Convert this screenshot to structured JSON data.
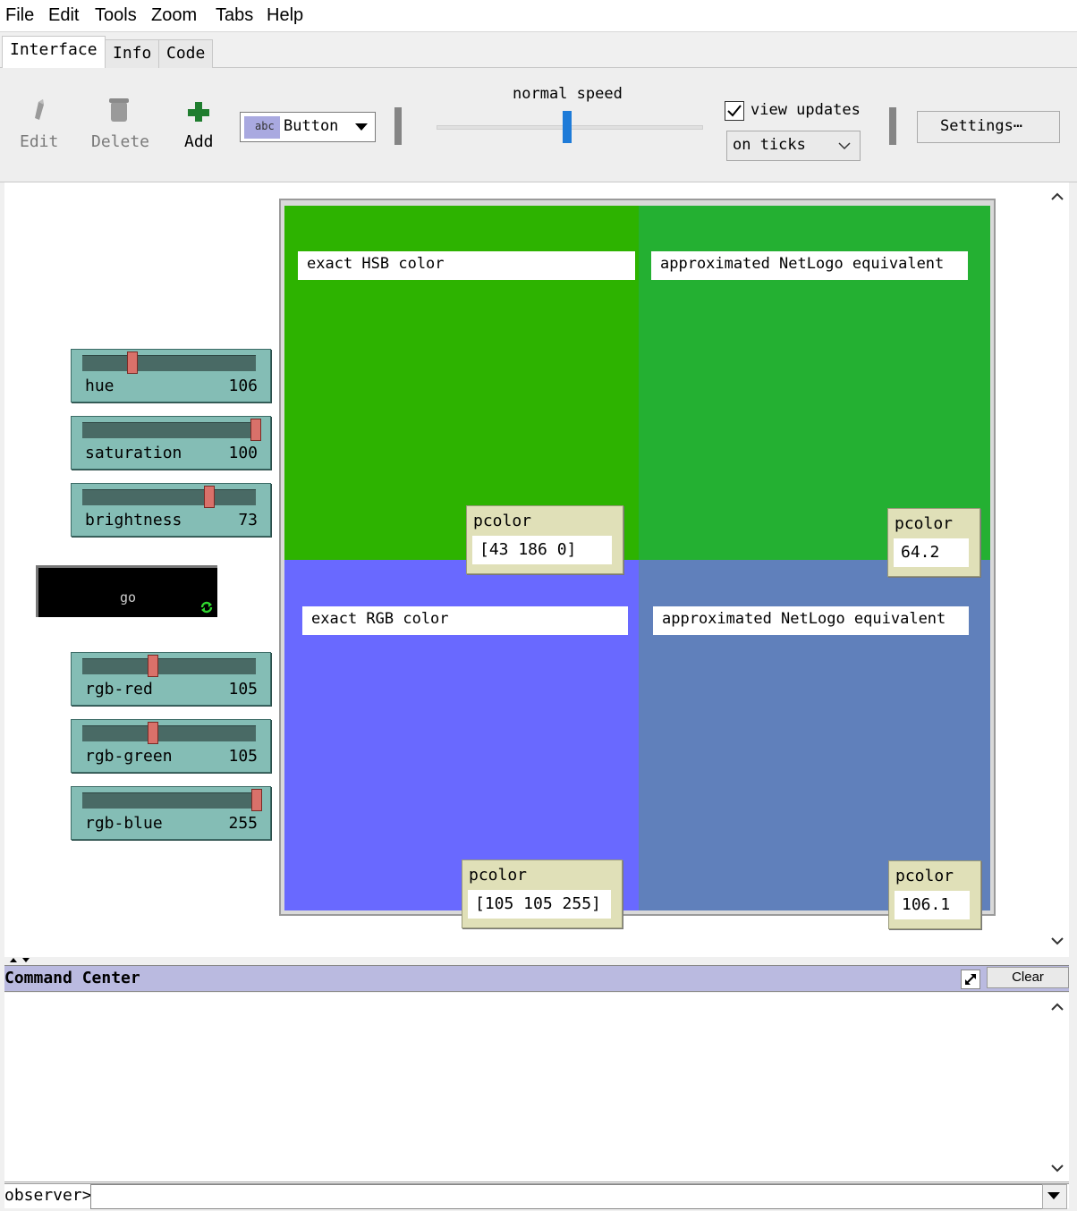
{
  "menu": [
    "File",
    "Edit",
    "Tools",
    "Zoom",
    "Tabs",
    "Help"
  ],
  "tabs": [
    "Interface",
    "Info",
    "Code"
  ],
  "toolbar": {
    "edit_label": "Edit",
    "delete_label": "Delete",
    "add_label": "Add",
    "widget_type": "Button",
    "widget_type_icon_text": "abc",
    "speed_label": "normal speed",
    "speed_value": 0.5,
    "view_updates_label": "view updates",
    "view_updates_checked": true,
    "update_mode": "on ticks",
    "settings_label": "Settings⋯"
  },
  "sliders": {
    "hue": {
      "label": "hue",
      "value": "106"
    },
    "saturation": {
      "label": "saturation",
      "value": "100"
    },
    "brightness": {
      "label": "brightness",
      "value": "73"
    },
    "rgb_red": {
      "label": "rgb-red",
      "value": "105"
    },
    "rgb_green": {
      "label": "rgb-green",
      "value": "105"
    },
    "rgb_blue": {
      "label": "rgb-blue",
      "value": "255"
    }
  },
  "go_button": {
    "label": "go",
    "forever": true
  },
  "view": {
    "patch_colors": {
      "hsb_exact": "#2db300",
      "hsb_approx": "#24b032",
      "rgb_exact": "#6969ff",
      "rgb_approx": "#6080bb"
    },
    "notes": {
      "hsb_exact": "exact HSB color",
      "hsb_approx": "approximated NetLogo equivalent",
      "rgb_exact": "exact RGB color",
      "rgb_approx": "approximated NetLogo equivalent"
    },
    "monitors": {
      "hsb_exact": {
        "label": "pcolor",
        "value": "[43 186 0]"
      },
      "hsb_approx": {
        "label": "pcolor",
        "value": "64.2"
      },
      "rgb_exact": {
        "label": "pcolor",
        "value": "[105 105 255]"
      },
      "rgb_approx": {
        "label": "pcolor",
        "value": "106.1"
      }
    }
  },
  "command_center": {
    "title": "Command Center",
    "clear_label": "Clear",
    "agent_label": "observer>"
  }
}
